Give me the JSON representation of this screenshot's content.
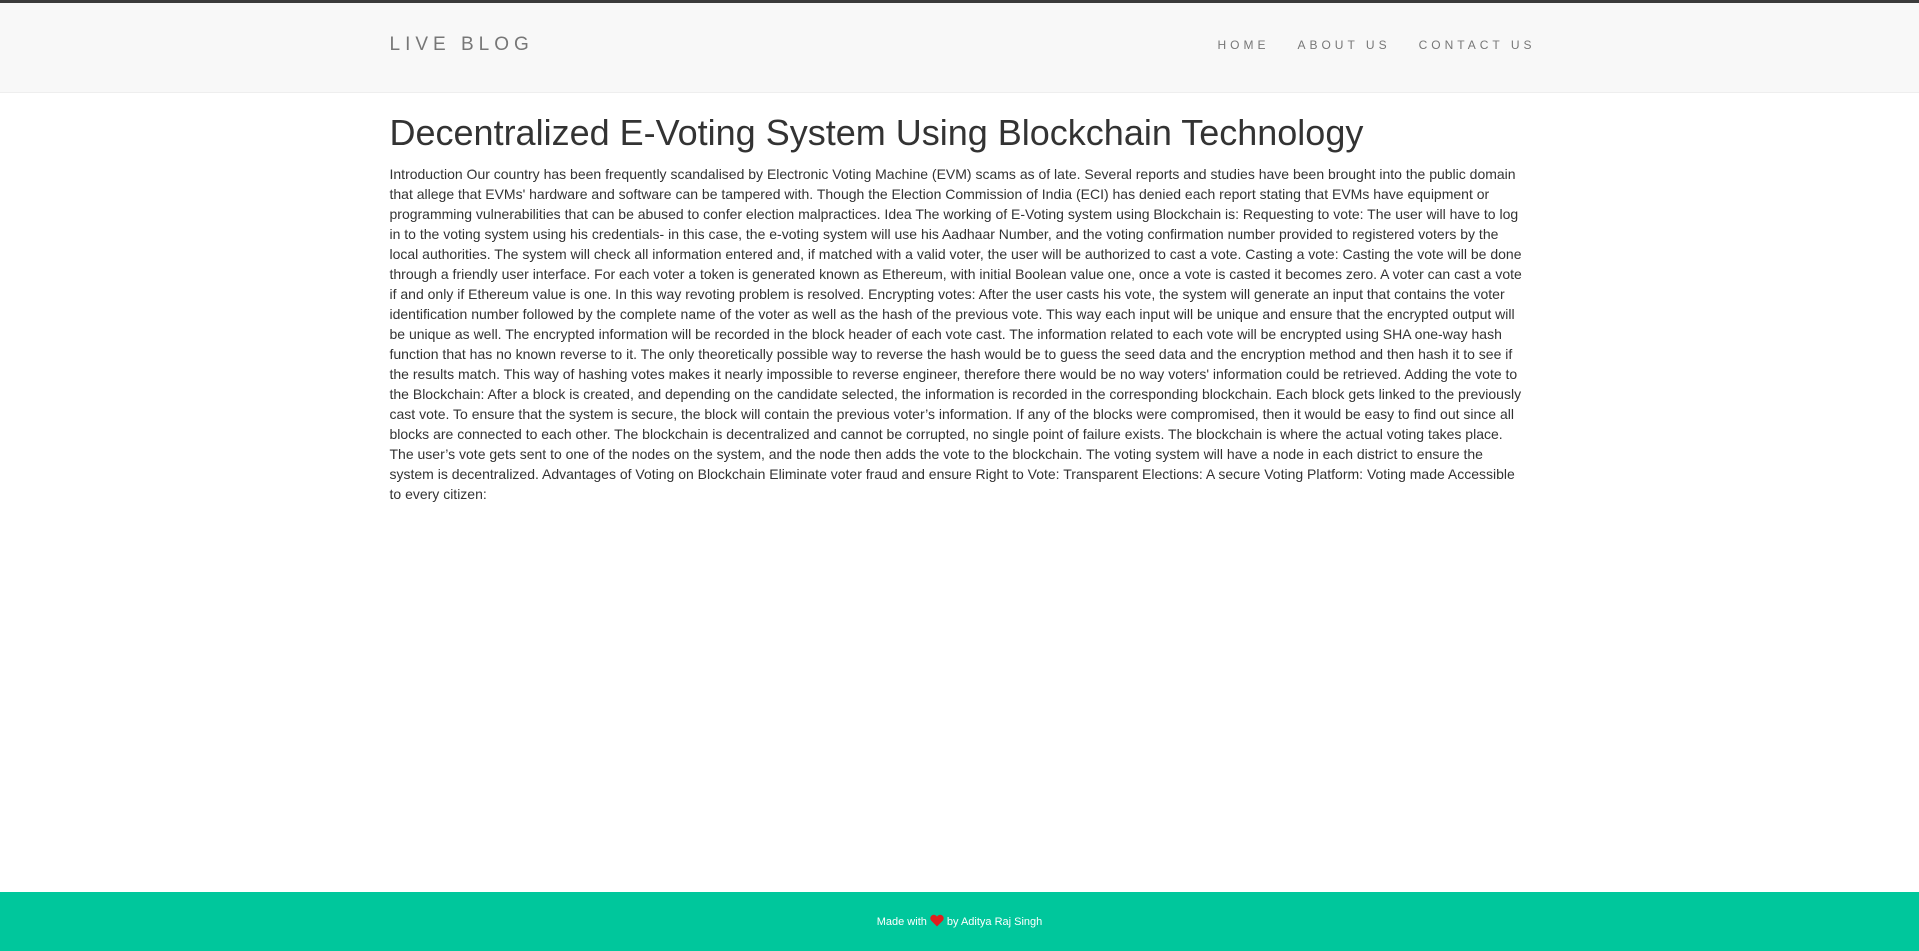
{
  "navbar": {
    "brand": "LIVE BLOG",
    "links": [
      {
        "label": "HOME"
      },
      {
        "label": "ABOUT US"
      },
      {
        "label": "CONTACT US"
      }
    ]
  },
  "post": {
    "title": "Decentralized E-Voting System Using Blockchain Technology",
    "body": "Introduction Our country has been frequently scandalised by Electronic Voting Machine (EVM) scams as of late. Several reports and studies have been brought into the public domain that allege that EVMs' hardware and software can be tampered with. Though the Election Commission of India (ECI) has denied each report stating that EVMs have equipment or programming vulnerabilities that can be abused to confer election malpractices. Idea The working of E-Voting system using Blockchain is: Requesting to vote: The user will have to log in to the voting system using his credentials- in this case, the e-voting system will use his Aadhaar Number, and the voting confirmation number provided to registered voters by the local authorities. The system will check all information entered and, if matched with a valid voter, the user will be authorized to cast a vote. Casting a vote: Casting the vote will be done through a friendly user interface. For each voter a token is generated known as Ethereum, with initial Boolean value one, once a vote is casted it becomes zero. A voter can cast a vote if and only if Ethereum value is one. In this way revoting problem is resolved. Encrypting votes: After the user casts his vote, the system will generate an input that contains the voter identification number followed by the complete name of the voter as well as the hash of the previous vote. This way each input will be unique and ensure that the encrypted output will be unique as well. The encrypted information will be recorded in the block header of each vote cast. The information related to each vote will be encrypted using SHA one-way hash function that has no known reverse to it. The only theoretically possible way to reverse the hash would be to guess the seed data and the encryption method and then hash it to see if the results match. This way of hashing votes makes it nearly impossible to reverse engineer, therefore there would be no way voters' information could be retrieved. Adding the vote to the Blockchain: After a block is created, and depending on the candidate selected, the information is recorded in the corresponding blockchain. Each block gets linked to the previously cast vote. To ensure that the system is secure, the block will contain the previous voter’s information. If any of the blocks were compromised, then it would be easy to find out since all blocks are connected to each other. The blockchain is decentralized and cannot be corrupted, no single point of failure exists. The blockchain is where the actual voting takes place. The user’s vote gets sent to one of the nodes on the system, and the node then adds the vote to the blockchain. The voting system will have a node in each district to ensure the system is decentralized. Advantages of Voting on Blockchain Eliminate voter fraud and ensure Right to Vote: Transparent Elections: A secure Voting Platform: Voting made Accessible to every citizen:"
  },
  "footer": {
    "prefix": "Made with",
    "suffix": "by Aditya Raj Singh",
    "heart_icon": "heart-icon"
  },
  "colors": {
    "footer_bg": "#00c79c",
    "heart": "#e01e1e",
    "navbar_bg": "#f8f8f8",
    "top_line": "#3b3b3b"
  }
}
